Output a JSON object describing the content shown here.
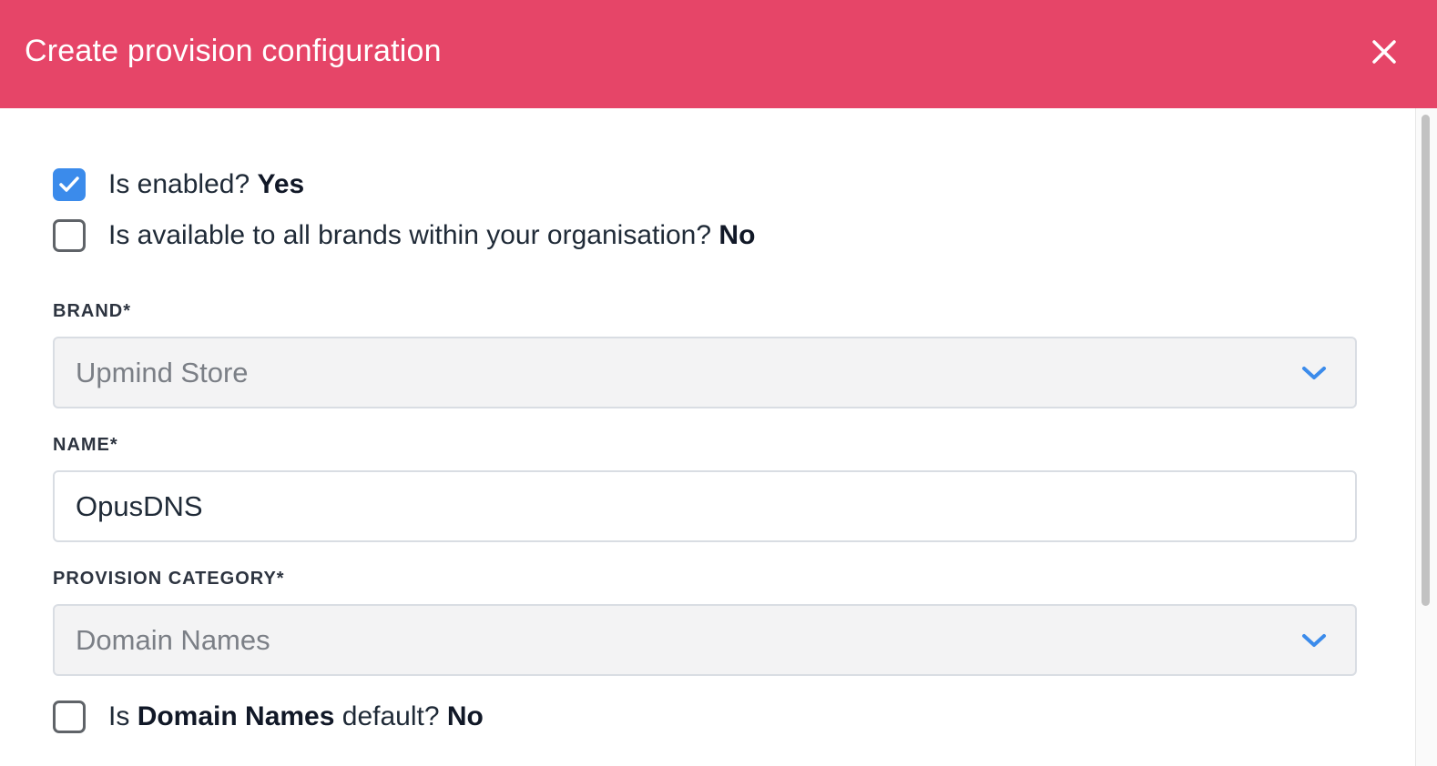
{
  "header": {
    "title": "Create provision configuration",
    "close_icon": "close-icon",
    "background_color": "#e64568"
  },
  "checkboxes": {
    "is_enabled": {
      "prefix": "Is enabled?",
      "value": "Yes",
      "checked": true
    },
    "all_brands": {
      "prefix": "Is available to all brands within your organisation?",
      "value": "No",
      "checked": false
    },
    "category_default": {
      "pre": "Is",
      "category": "Domain Names",
      "post": "default?",
      "value": "No",
      "checked": false
    }
  },
  "fields": {
    "brand": {
      "label": "BRAND*",
      "value": "Upmind Store",
      "icon": "chevron-down-icon"
    },
    "name": {
      "label": "NAME*",
      "value": "OpusDNS"
    },
    "provision_category": {
      "label": "PROVISION CATEGORY*",
      "value": "Domain Names",
      "icon": "chevron-down-icon"
    }
  },
  "colors": {
    "accent": "#3b8beb",
    "header": "#e64568",
    "select_bg": "#f3f3f4"
  }
}
